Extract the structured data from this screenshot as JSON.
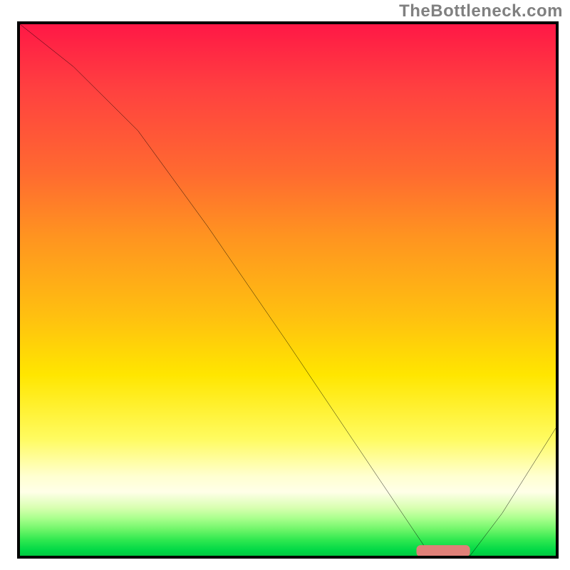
{
  "watermark": "TheBottleneck.com",
  "chart_data": {
    "type": "line",
    "title": "",
    "xlabel": "",
    "ylabel": "",
    "xlim": [
      0,
      100
    ],
    "ylim": [
      0,
      100
    ],
    "grid": false,
    "legend": false,
    "series": [
      {
        "name": "bottleneck-curve",
        "x": [
          0,
          10,
          22,
          35,
          50,
          62,
          72,
          76,
          80,
          84,
          90,
          100
        ],
        "y": [
          100,
          92,
          80,
          62,
          40,
          22,
          7,
          1,
          0,
          0,
          8,
          24
        ]
      }
    ],
    "marker": {
      "name": "optimal-band",
      "x_center": 79,
      "x_halfwidth": 5,
      "y": 1,
      "color": "#e08078"
    },
    "gradient_stops": [
      {
        "pct": 0,
        "color": "#ff1846"
      },
      {
        "pct": 12,
        "color": "#ff4040"
      },
      {
        "pct": 28,
        "color": "#ff6a30"
      },
      {
        "pct": 40,
        "color": "#ff9420"
      },
      {
        "pct": 55,
        "color": "#ffc010"
      },
      {
        "pct": 66,
        "color": "#ffe600"
      },
      {
        "pct": 78,
        "color": "#fffb60"
      },
      {
        "pct": 85,
        "color": "#ffffd0"
      },
      {
        "pct": 88,
        "color": "#ffffe8"
      },
      {
        "pct": 91,
        "color": "#d8ffb0"
      },
      {
        "pct": 93,
        "color": "#a8ff8c"
      },
      {
        "pct": 95,
        "color": "#70f66a"
      },
      {
        "pct": 97,
        "color": "#30e850"
      },
      {
        "pct": 99,
        "color": "#00d846"
      },
      {
        "pct": 100,
        "color": "#00c840"
      }
    ]
  }
}
